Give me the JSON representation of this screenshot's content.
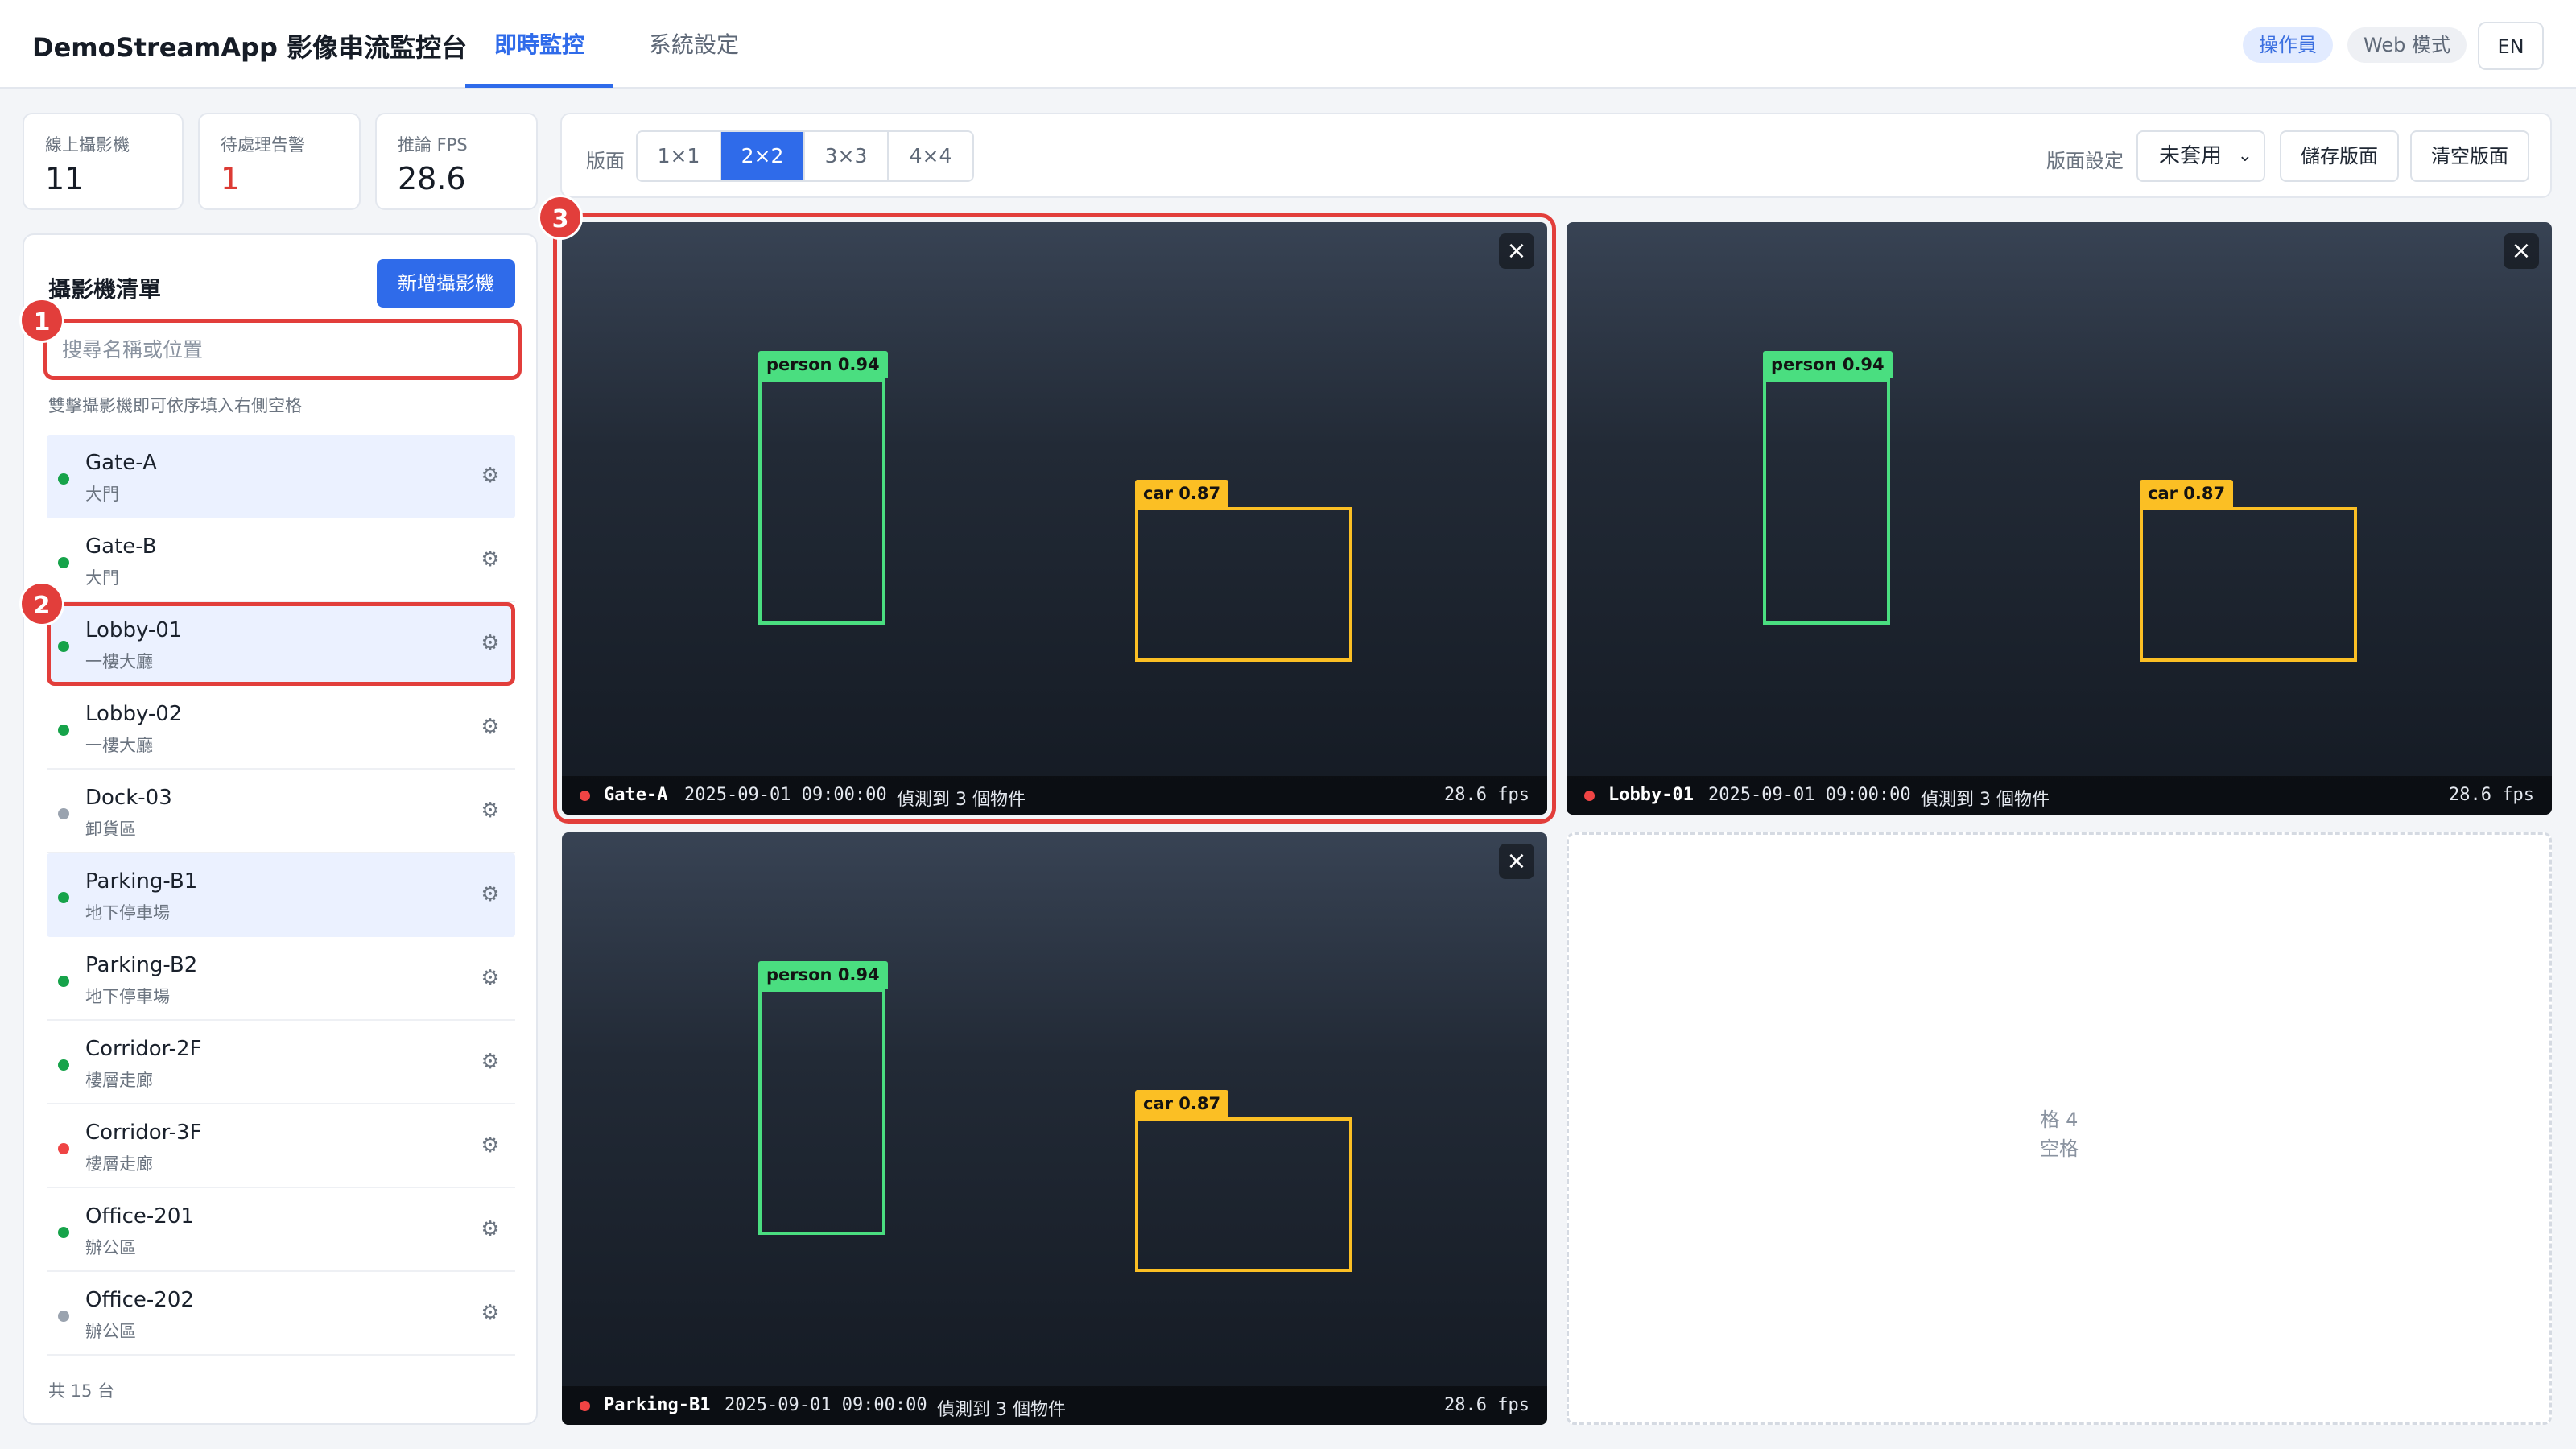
{
  "header": {
    "brand": "DemoStreamApp 影像串流監控台",
    "tabs": [
      {
        "label": "即時監控",
        "active": true
      },
      {
        "label": "系統設定",
        "active": false
      }
    ],
    "role_badge": "操作員",
    "mode_badge": "Web 模式",
    "lang_button": "EN"
  },
  "stats": [
    {
      "label": "線上攝影機",
      "value": "11",
      "tone": "normal"
    },
    {
      "label": "待處理告警",
      "value": "1",
      "tone": "alert"
    },
    {
      "label": "推論 FPS",
      "value": "28.6",
      "tone": "normal"
    }
  ],
  "sidebar": {
    "title": "攝影機清單",
    "add_button": "新增攝影機",
    "search_placeholder": "搜尋名稱或位置",
    "hint": "雙擊攝影機即可依序填入右側空格",
    "cameras": [
      {
        "name": "Gate-A",
        "location": "大門",
        "status": "online",
        "selected": true
      },
      {
        "name": "Gate-B",
        "location": "大門",
        "status": "online",
        "selected": false
      },
      {
        "name": "Lobby-01",
        "location": "一樓大廳",
        "status": "online",
        "selected": true
      },
      {
        "name": "Lobby-02",
        "location": "一樓大廳",
        "status": "online",
        "selected": false
      },
      {
        "name": "Dock-03",
        "location": "卸貨區",
        "status": "offline",
        "selected": false
      },
      {
        "name": "Parking-B1",
        "location": "地下停車場",
        "status": "online",
        "selected": true
      },
      {
        "name": "Parking-B2",
        "location": "地下停車場",
        "status": "online",
        "selected": false
      },
      {
        "name": "Corridor-2F",
        "location": "樓層走廊",
        "status": "online",
        "selected": false
      },
      {
        "name": "Corridor-3F",
        "location": "樓層走廊",
        "status": "alert",
        "selected": false
      },
      {
        "name": "Office-201",
        "location": "辦公區",
        "status": "online",
        "selected": false
      },
      {
        "name": "Office-202",
        "location": "辦公區",
        "status": "offline",
        "selected": false
      }
    ],
    "count_text": "共 15 台"
  },
  "status_colors": {
    "online": "#16a34a",
    "offline": "#9aa3af",
    "alert": "#ef4444"
  },
  "toolbar": {
    "layout_label": "版面",
    "layouts": [
      "1×1",
      "2×2",
      "3×3",
      "4×4"
    ],
    "active_layout": "2×2",
    "preset_label": "版面設定",
    "preset_value": "未套用",
    "save_button": "儲存版面",
    "clear_button": "清空版面"
  },
  "tiles": [
    {
      "camera": "Gate-A",
      "timestamp": "2025-09-01 09:00:00",
      "detections": "偵測到 3 個物件",
      "fps": "28.6 fps",
      "person_label": "person 0.94",
      "car_label": "car 0.87",
      "close_icon": "×"
    },
    {
      "camera": "Lobby-01",
      "timestamp": "2025-09-01 09:00:00",
      "detections": "偵測到 3 個物件",
      "fps": "28.6 fps",
      "person_label": "person 0.94",
      "car_label": "car 0.87",
      "close_icon": "×"
    },
    {
      "camera": "Parking-B1",
      "timestamp": "2025-09-01 09:00:00",
      "detections": "偵測到 3 個物件",
      "fps": "28.6 fps",
      "person_label": "person 0.94",
      "car_label": "car 0.87",
      "close_icon": "×"
    }
  ],
  "empty_slot": {
    "slot_label": "格 4",
    "text": "空格"
  },
  "markers": [
    "1",
    "2",
    "3"
  ],
  "colors": {
    "accent": "#2f6bea",
    "annotation": "#e23e3b",
    "person_box": "#4ade80",
    "car_box": "#fbbf24"
  }
}
